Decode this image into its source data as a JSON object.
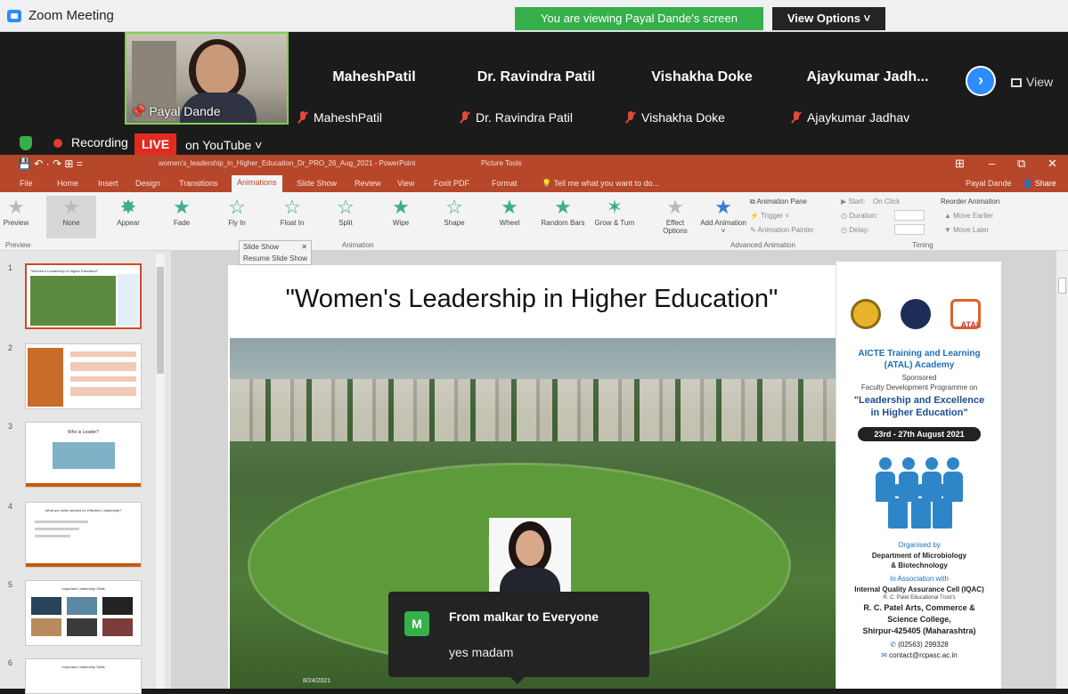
{
  "zoom": {
    "window_title": "Zoom Meeting",
    "viewing_banner": "You are viewing Payal Dande's screen",
    "view_options": "View Options ˅",
    "view_button": "View",
    "next_icon": "chevron-right-icon",
    "active_speaker": {
      "name": "Payal Dande"
    },
    "participants": [
      {
        "big": "MaheshPatil",
        "small": "MaheshPatil"
      },
      {
        "big": "Dr. Ravindra Patil",
        "small": "Dr. Ravindra Patil"
      },
      {
        "big": "Vishakha Doke",
        "small": "Vishakha Doke"
      },
      {
        "big": "Ajaykumar  Jadh...",
        "small": "Ajaykumar Jadhav"
      }
    ],
    "recording": "Recording",
    "live_badge": "LIVE",
    "stream_target": "on YouTube ˅"
  },
  "ppt": {
    "doc_title": "women's_leadership_in_Higher_Education_Dr_PRO_26_Aug_2021 - PowerPoint",
    "picture_tools": "Picture Tools",
    "quick_access": "💾 ↶ · ↷ ⊞ =",
    "tabs": [
      "File",
      "Home",
      "Insert",
      "Design",
      "Transitions",
      "Animations",
      "Slide Show",
      "Review",
      "View",
      "Foxit PDF",
      "Format"
    ],
    "active_tab": "Animations",
    "tell_me": "Tell me what you want to do...",
    "user": "Payal Dande",
    "share": "Share",
    "preview_label": "Preview",
    "preview_group": "Preview",
    "animations": [
      "None",
      "Appear",
      "Fade",
      "Fly In",
      "Float In",
      "Split",
      "Wipe",
      "Shape",
      "Wheel",
      "Random Bars",
      "Grow & Turn"
    ],
    "effect_options": "Effect Options",
    "animation_group": "Animation",
    "add_animation": "Add Animation ˅",
    "animation_pane": "Animation Pane",
    "trigger": "Trigger ˅",
    "animation_painter": "Animation Painter",
    "advanced_group": "Advanced Animation",
    "start_label": "Start:",
    "start_value": "On Click",
    "duration_label": "Duration:",
    "delay_label": "Delay:",
    "timing_group": "Timing",
    "reorder_label": "Reorder Animation",
    "move_earlier": "▲ Move Earlier",
    "move_later": "▼ Move Later",
    "slideshow_mini": "Slide Show",
    "resume_slideshow": "Resume Slide Show",
    "slide_numbers": [
      "1",
      "2",
      "3",
      "4",
      "5",
      "6"
    ],
    "thumb_titles": [
      "\"Women's Leadership in Higher Education\"",
      "",
      "Who is Leader?",
      "What are skills needed for Effective Leadership?",
      "Important Leadership Skills",
      "Important Leadership Skills"
    ]
  },
  "slide": {
    "title": "\"Women's Leadership in Higher Education\"",
    "date": "8/24/2021"
  },
  "poster": {
    "logos_text": "ATAL",
    "academy": "AICTE Training and Learning",
    "academy2": "(ATAL) Academy",
    "sponsored": "Sponsored",
    "fdp": "Faculty Development Programme on",
    "program": "\"Leadership and Excellence",
    "program2": "in Higher Education\"",
    "dates": "23rd - 27th August 2021",
    "organised": "Organised by",
    "dept": "Department of Microbiology",
    "dept2": "& Biotechnology",
    "assoc": "In Association with",
    "iqac": "Internal Quality Assurance Cell (IQAC)",
    "trust": "R. C. Patel Educational Trust's",
    "college": "R. C. Patel Arts, Commerce &",
    "college2": "Science College,",
    "address": "Shirpur-425405 (Maharashtra)",
    "phone": "(02563) 299328",
    "email": "contact@rcpasc.ac.in"
  },
  "chat": {
    "avatar_letter": "M",
    "from": "From malkar to Everyone",
    "message": "yes madam"
  },
  "colors": {
    "ppt_brand": "#b7472a",
    "zoom_green": "#35b04a",
    "zoom_blue": "#2d8cff",
    "live_red": "#e02b20"
  }
}
